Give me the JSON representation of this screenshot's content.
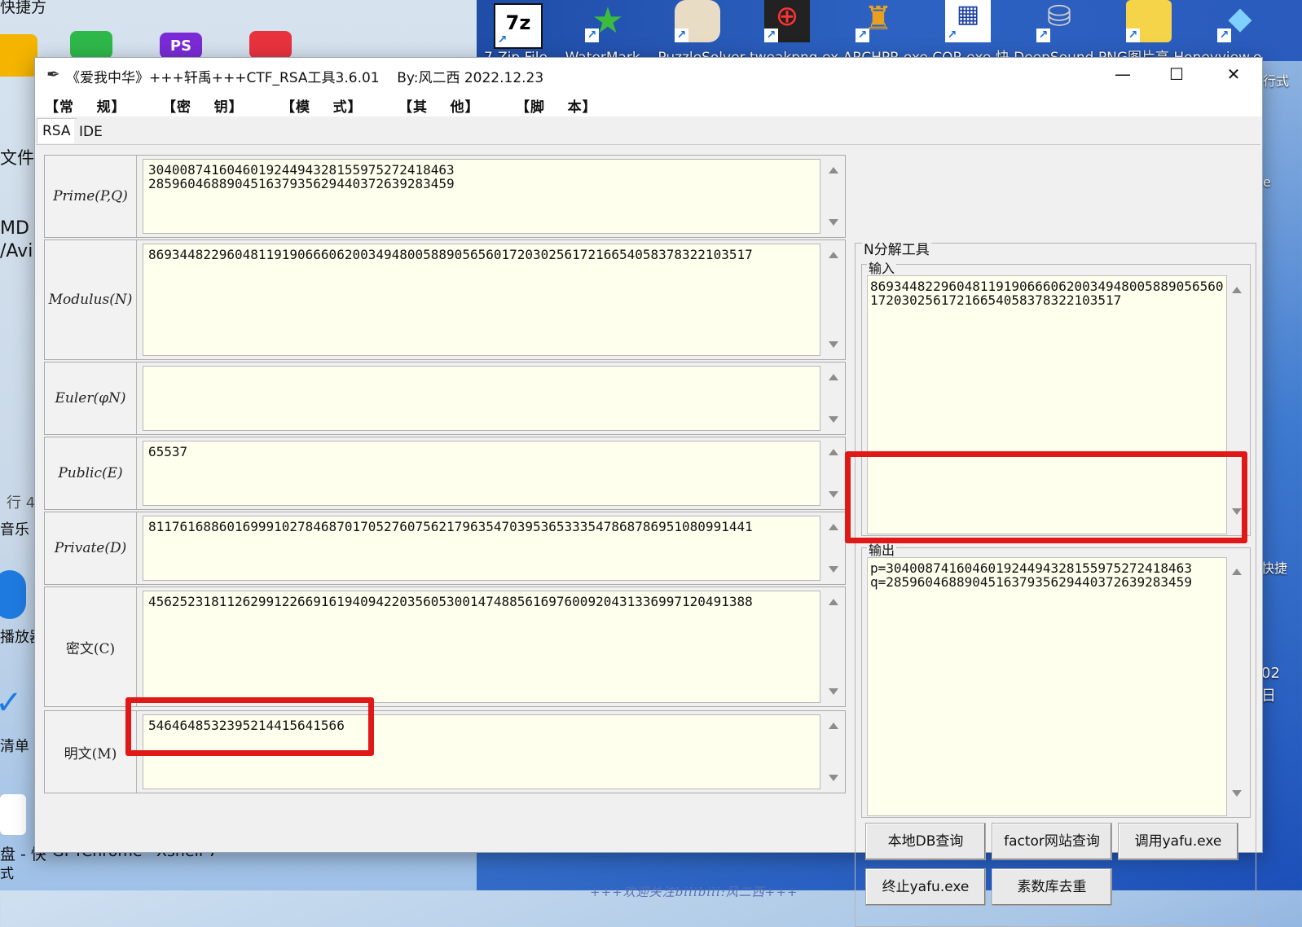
{
  "desktop": {
    "top_left_label": "快捷方",
    "icon_labels_top": "7-Zip File... WaterMark... PuzzleSolver tweakpng.ex ARCHPR.exe COR.exe 快 DeepSound PNG图片高 Honeyview.e",
    "side_left_labels": [
      "文件",
      "MD",
      "/Avi",
      "行 4",
      "音乐",
      "播放器",
      "清单"
    ],
    "side_right_labels": [
      "e",
      "快捷",
      "02",
      "日",
      "行式"
    ],
    "taskbar_labels": [
      "盘 - 快",
      "GPT",
      "Chrome",
      "Xshell 7"
    ],
    "taskbar_label_sub": "式"
  },
  "window": {
    "title": "《爱我中华》+++轩禹+++CTF_RSA工具3.6.01    By:风二西 2022.12.23",
    "controls": {
      "minimize": "—",
      "maximize": "☐",
      "close": "✕"
    },
    "menu": [
      "【常    规】",
      "【密    钥】",
      "【模    式】",
      "【其    他】",
      "【脚    本】"
    ],
    "tabs": [
      "RSA",
      "IDE"
    ],
    "active_tab": "RSA"
  },
  "rsa": {
    "rows": [
      {
        "label": "Prime(P,Q)",
        "value": "304008741604601924494328155975272418463\n285960468890451637935629440372639283459"
      },
      {
        "label": "Modulus(N)",
        "value": "869344822960481191906660620034948005889056560172030256172166540583783221035​17"
      },
      {
        "label": "Euler(φN)",
        "value": ""
      },
      {
        "label": "Public(E)",
        "value": "65537"
      },
      {
        "label": "Private(D)",
        "value": "81176168860169991027846870170527607562179635470395365333547868786951080991441"
      },
      {
        "label": "密文(C)",
        "value": "45625231811262991226691619409422035605300147488561697600920431336997120491388"
      },
      {
        "label": "明文(M)",
        "value": "5464648532395214415641566"
      }
    ],
    "footer": "+++欢迎关注bilibili:风二西+++"
  },
  "factor": {
    "group_title": "N分解工具",
    "input_label": "输入",
    "input_value": "869344822960481191906660620034948005889056560172030256172166540583783221035​17",
    "output_label": "输出",
    "output_value": "p=304008741604601924494328155975272418463\nq=285960468890451637935629440372639283459",
    "buttons": [
      "本地DB查询",
      "factor网站查询",
      "调用yafu.exe",
      "终止yafu.exe",
      "素数库去重"
    ]
  },
  "colors": {
    "highlight": "#e01818",
    "field_bg": "#ffffee",
    "window_bg": "#f0f0f0"
  }
}
